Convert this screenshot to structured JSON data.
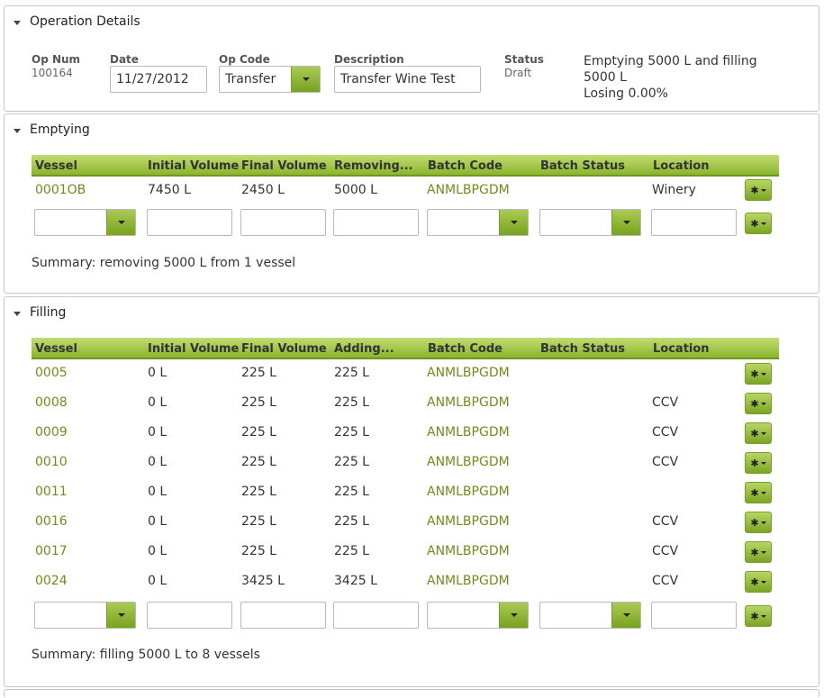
{
  "operation": {
    "title": "Operation Details",
    "op_num_label": "Op Num",
    "op_num": "100164",
    "date_label": "Date",
    "date": "11/27/2012",
    "op_code_label": "Op Code",
    "op_code": "Transfer",
    "description_label": "Description",
    "description": "Transfer Wine Test",
    "status_label": "Status",
    "status": "Draft",
    "status_line1": "Emptying 5000 L and filling",
    "status_line2": "5000 L",
    "status_line3": "Losing 0.00%"
  },
  "emptying": {
    "title": "Emptying",
    "headers": [
      "Vessel",
      "Initial Volume",
      "Final Volume",
      "Removing...",
      "Batch Code",
      "Batch Status",
      "Location"
    ],
    "rows": [
      {
        "vessel": "0001OB",
        "initial": "7450 L",
        "final": "2450 L",
        "change": "5000 L",
        "batch": "ANMLBPGDM",
        "status": "",
        "location": "Winery"
      }
    ],
    "summary": "Summary: removing 5000 L from 1 vessel"
  },
  "filling": {
    "title": "Filling",
    "headers": [
      "Vessel",
      "Initial Volume",
      "Final Volume",
      "Adding...",
      "Batch Code",
      "Batch Status",
      "Location"
    ],
    "rows": [
      {
        "vessel": "0005",
        "initial": "0 L",
        "final": "225 L",
        "change": "225 L",
        "batch": "ANMLBPGDM",
        "status": "",
        "location": ""
      },
      {
        "vessel": "0008",
        "initial": "0 L",
        "final": "225 L",
        "change": "225 L",
        "batch": "ANMLBPGDM",
        "status": "",
        "location": "CCV"
      },
      {
        "vessel": "0009",
        "initial": "0 L",
        "final": "225 L",
        "change": "225 L",
        "batch": "ANMLBPGDM",
        "status": "",
        "location": "CCV"
      },
      {
        "vessel": "0010",
        "initial": "0 L",
        "final": "225 L",
        "change": "225 L",
        "batch": "ANMLBPGDM",
        "status": "",
        "location": "CCV"
      },
      {
        "vessel": "0011",
        "initial": "0 L",
        "final": "225 L",
        "change": "225 L",
        "batch": "ANMLBPGDM",
        "status": "",
        "location": ""
      },
      {
        "vessel": "0016",
        "initial": "0 L",
        "final": "225 L",
        "change": "225 L",
        "batch": "ANMLBPGDM",
        "status": "",
        "location": "CCV"
      },
      {
        "vessel": "0017",
        "initial": "0 L",
        "final": "225 L",
        "change": "225 L",
        "batch": "ANMLBPGDM",
        "status": "",
        "location": "CCV"
      },
      {
        "vessel": "0024",
        "initial": "0 L",
        "final": "3425 L",
        "change": "3425 L",
        "batch": "ANMLBPGDM",
        "status": "",
        "location": "CCV"
      }
    ],
    "summary": "Summary: filling 5000 L to 8 vessels"
  },
  "icons": {
    "expand": "caret-down-icon",
    "gear": "gear-icon",
    "dropdown": "chevron-down-icon"
  },
  "colors": {
    "accent": "#8bb52c",
    "link": "#6f8d1d"
  }
}
